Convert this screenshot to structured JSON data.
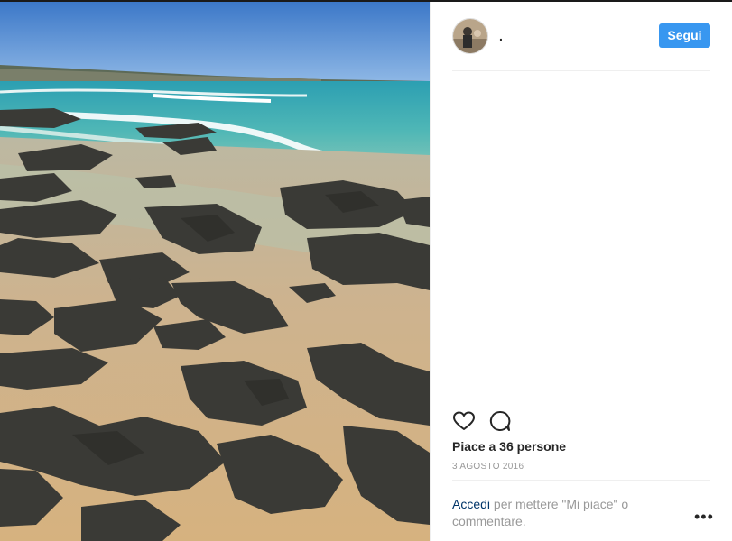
{
  "post": {
    "image_alt": "Rocky beach with turquoise sea",
    "username": ".",
    "follow_label": "Segui",
    "likes_text": "Piace a 36 persone",
    "date": "3 AGOSTO 2016",
    "login_link": "Accedi",
    "login_text": " per mettere \"Mi piace\" o commentare.",
    "more_label": "•••"
  },
  "icons": [
    "heart-icon",
    "comment-icon",
    "more-options-icon"
  ],
  "colors": {
    "follow": "#3897f0",
    "link": "#003569",
    "muted": "#999999",
    "text": "#262626"
  }
}
